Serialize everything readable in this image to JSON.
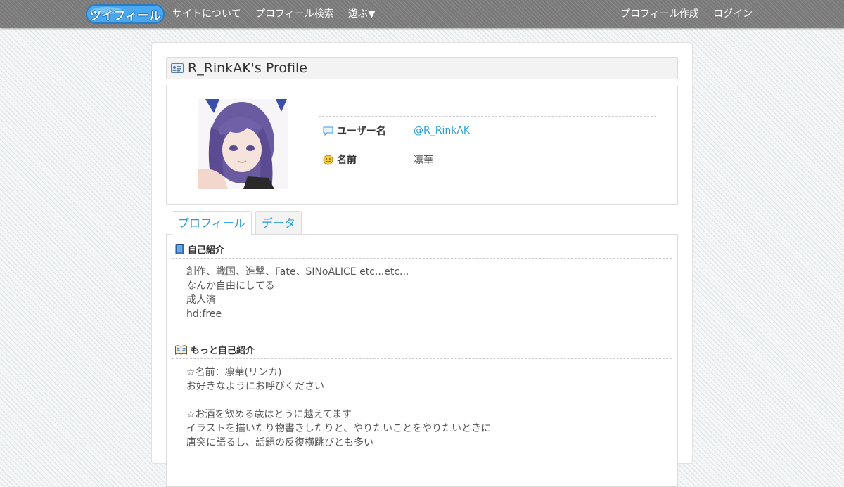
{
  "nav": {
    "logo_text": "ツイフィール",
    "about": "サイトについて",
    "search": "プロフィール検索",
    "play": "遊ぶ▼",
    "create": "プロフィール作成",
    "login": "ログイン"
  },
  "profile": {
    "title": "R_RinkAK's Profile",
    "username_label": "ユーザー名",
    "username_value": "@R_RinkAK",
    "name_label": "名前",
    "name_value": "凛華"
  },
  "tabs": [
    {
      "label": "プロフィール",
      "active": true
    },
    {
      "label": "データ",
      "active": false
    }
  ],
  "sections": {
    "intro": {
      "heading": "自己紹介",
      "lines": [
        "創作、戦国、進撃、Fate、SINoALICE etc...etc...",
        "なんか自由にしてる",
        "成人済",
        "hd:free"
      ]
    },
    "more": {
      "heading": "もっと自己紹介",
      "lines": [
        "☆名前：凛華(リンカ)",
        "お好きなようにお呼びください",
        "",
        "☆お酒を飲める歳はとうに越えてます",
        "イラストを描いたり物書きしたりと、やりたいことをやりたいときに",
        "唐突に語るし、話題の反復横跳びとも多い"
      ]
    }
  },
  "colors": {
    "accent": "#2a9fd6",
    "logo_blue": "#3b9be8"
  }
}
